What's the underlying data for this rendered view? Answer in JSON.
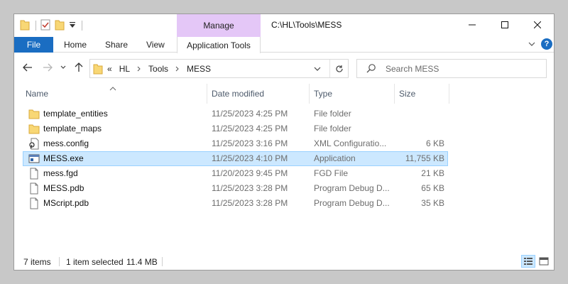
{
  "titlebar": {
    "path_title": "C:\\HL\\Tools\\MESS",
    "manage_label": "Manage"
  },
  "ribbon": {
    "tabs": [
      "File",
      "Home",
      "Share",
      "View"
    ],
    "app_tools_label": "Application Tools"
  },
  "address": {
    "overflow": "«",
    "crumbs": [
      "HL",
      "Tools",
      "MESS"
    ]
  },
  "search": {
    "placeholder": "Search MESS"
  },
  "columns": {
    "name": "Name",
    "date": "Date modified",
    "type": "Type",
    "size": "Size"
  },
  "files": [
    {
      "name": "template_entities",
      "date": "11/25/2023 4:25 PM",
      "type": "File folder",
      "size": "",
      "icon": "folder-icon"
    },
    {
      "name": "template_maps",
      "date": "11/25/2023 4:25 PM",
      "type": "File folder",
      "size": "",
      "icon": "folder-icon"
    },
    {
      "name": "mess.config",
      "date": "11/25/2023 3:16 PM",
      "type": "XML Configuratio...",
      "size": "6 KB",
      "icon": "config-file-icon"
    },
    {
      "name": "MESS.exe",
      "date": "11/25/2023 4:10 PM",
      "type": "Application",
      "size": "11,755 KB",
      "icon": "application-icon"
    },
    {
      "name": "mess.fgd",
      "date": "11/20/2023 9:45 PM",
      "type": "FGD File",
      "size": "21 KB",
      "icon": "file-icon"
    },
    {
      "name": "MESS.pdb",
      "date": "11/25/2023 3:28 PM",
      "type": "Program Debug D...",
      "size": "65 KB",
      "icon": "file-icon"
    },
    {
      "name": "MScript.pdb",
      "date": "11/25/2023 3:28 PM",
      "type": "Program Debug D...",
      "size": "35 KB",
      "icon": "file-icon"
    }
  ],
  "selected_index": 3,
  "status": {
    "item_count": "7 items",
    "selection": "1 item selected",
    "selection_size": "11.4 MB"
  },
  "colors": {
    "accent": "#1a6dc2",
    "manage_tab": "#e4c7f7",
    "selection_bg": "#cce8ff",
    "selection_border": "#99d1ff",
    "folder": "#f8d775"
  }
}
